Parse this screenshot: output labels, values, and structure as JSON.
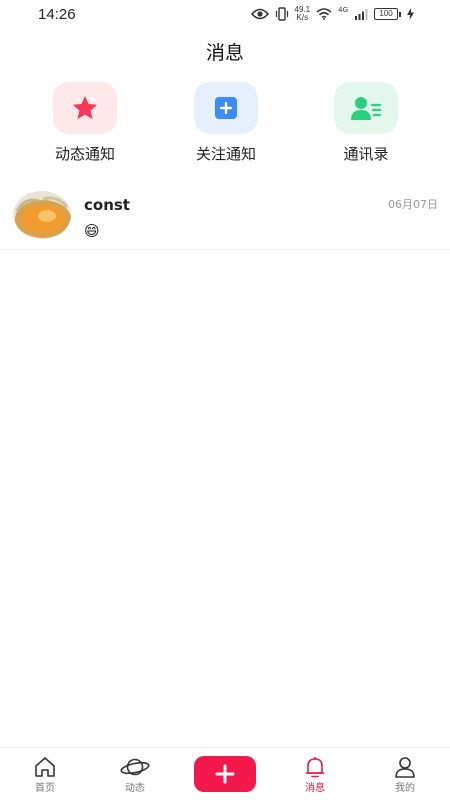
{
  "status_bar": {
    "time": "14:26",
    "speed_value": "49.1",
    "speed_unit": "K/s",
    "network": "4G",
    "battery": "100"
  },
  "header": {
    "title": "消息"
  },
  "quick_entries": [
    {
      "label": "动态通知",
      "icon": "star-icon",
      "color": "#f5385a",
      "bg": "#fde8ea"
    },
    {
      "label": "关注通知",
      "icon": "plus-square-icon",
      "color": "#3b8cf3",
      "bg": "#e6f0fd"
    },
    {
      "label": "通讯录",
      "icon": "contacts-icon",
      "color": "#2bd07d",
      "bg": "#e3f7ed"
    }
  ],
  "conversations": [
    {
      "name": "const",
      "preview": "😄",
      "time": "06月07日"
    }
  ],
  "tab_bar": {
    "active": "消息",
    "accent": "#e8194a",
    "items": [
      {
        "label": "首页",
        "icon": "home-icon"
      },
      {
        "label": "动态",
        "icon": "planet-icon"
      },
      {
        "label": "消息",
        "icon": "bell-icon"
      },
      {
        "label": "我的",
        "icon": "user-icon"
      }
    ],
    "post_button": {
      "icon": "plus-icon",
      "color": "#f2184b"
    }
  }
}
